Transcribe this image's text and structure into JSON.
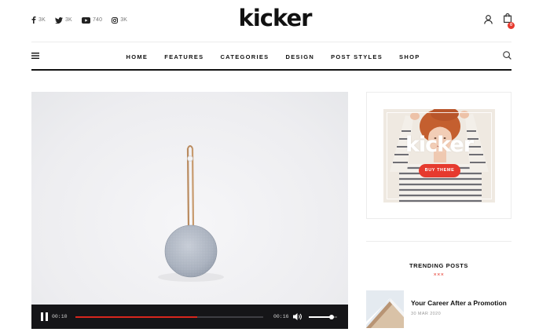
{
  "site": {
    "logo": "kicker"
  },
  "social": [
    {
      "icon": "facebook-icon",
      "count": "3K"
    },
    {
      "icon": "twitter-icon",
      "count": "3K"
    },
    {
      "icon": "youtube-icon",
      "count": "740"
    },
    {
      "icon": "instagram-icon",
      "count": "3K"
    }
  ],
  "cart": {
    "count": "0"
  },
  "nav": {
    "links": [
      "HOME",
      "FEATURES",
      "CATEGORIES",
      "DESIGN",
      "POST STYLES",
      "SHOP"
    ]
  },
  "video": {
    "current_time": "00:10",
    "duration": "00:16",
    "progress": 0.65,
    "volume": 0.8
  },
  "ad": {
    "logo": "kicker",
    "button": "BUY THEME"
  },
  "trending": {
    "title": "TRENDING POSTS",
    "decoration": "×××",
    "posts": [
      {
        "headline": "Your Career After a Promotion",
        "date": "30 MAR 2020"
      }
    ]
  },
  "colors": {
    "accent": "#e63a2e",
    "progress": "#d8261d",
    "controls_bg": "#151518"
  }
}
